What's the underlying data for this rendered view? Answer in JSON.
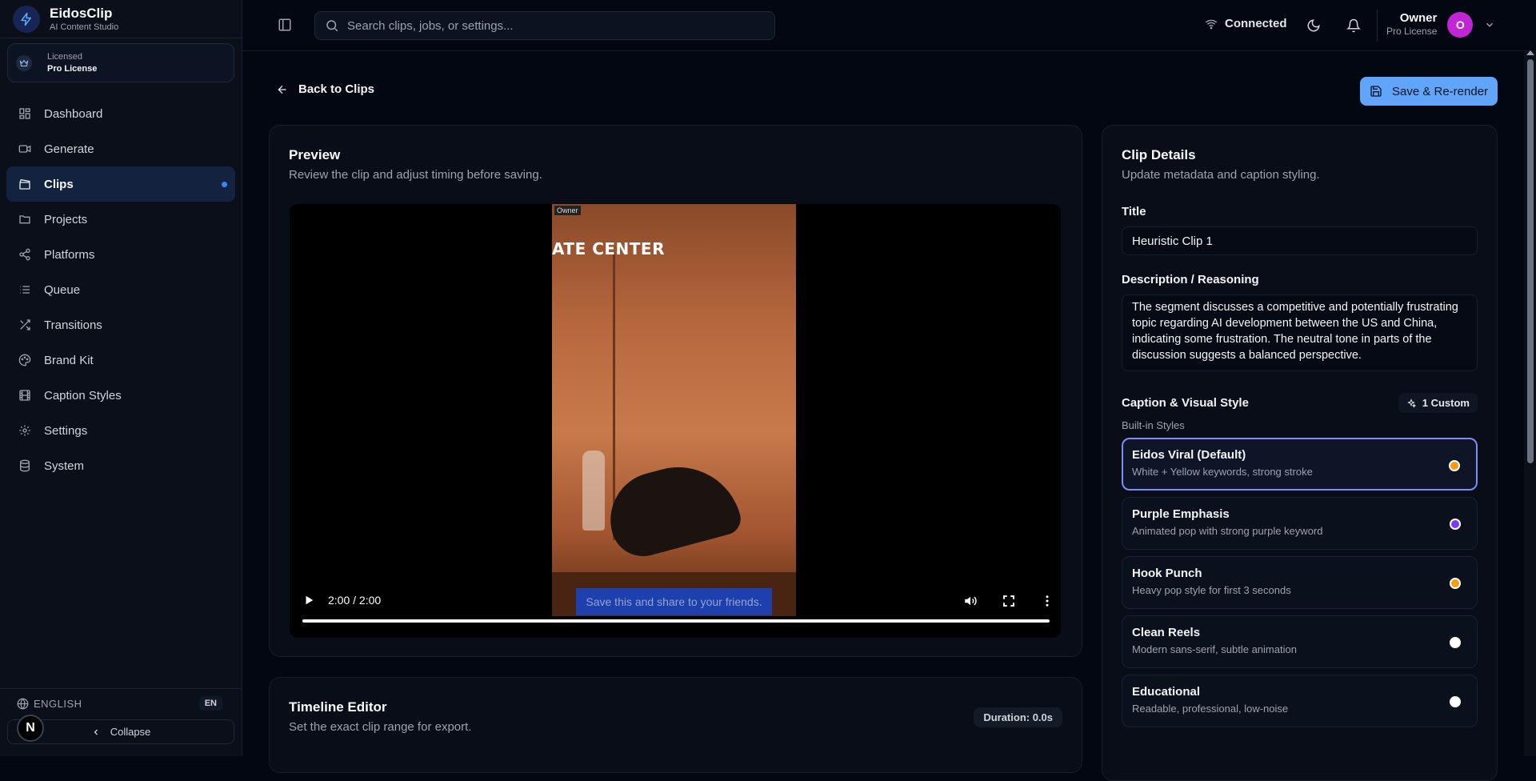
{
  "app": {
    "name": "EidosClip",
    "subtitle": "AI Content Studio"
  },
  "license": {
    "label": "Licensed",
    "value": "Pro License"
  },
  "nav": {
    "items": [
      {
        "label": "Dashboard",
        "icon": "dashboard-icon"
      },
      {
        "label": "Generate",
        "icon": "video-icon"
      },
      {
        "label": "Clips",
        "icon": "clapperboard-icon",
        "active": true
      },
      {
        "label": "Projects",
        "icon": "folder-icon"
      },
      {
        "label": "Platforms",
        "icon": "share-icon"
      },
      {
        "label": "Queue",
        "icon": "list-icon"
      },
      {
        "label": "Transitions",
        "icon": "shuffle-icon"
      },
      {
        "label": "Brand Kit",
        "icon": "palette-icon"
      },
      {
        "label": "Caption Styles",
        "icon": "film-icon"
      },
      {
        "label": "Settings",
        "icon": "gear-icon"
      },
      {
        "label": "System",
        "icon": "database-icon"
      }
    ]
  },
  "sidebar_bottom": {
    "language": "ENGLISH",
    "language_code": "EN",
    "collapse_label": "Collapse",
    "avatar_letter": "N"
  },
  "topbar": {
    "search_placeholder": "Search clips, jobs, or settings...",
    "connection_status": "Connected",
    "user_name": "Owner",
    "user_role": "Pro License",
    "user_initial": "O"
  },
  "page": {
    "back_label": "Back to Clips",
    "save_label": "Save & Re-render"
  },
  "preview": {
    "title": "Preview",
    "subtitle": "Review the clip and adjust timing before saving.",
    "frame_tag": "Owner",
    "frame_sign": "ATE CENTER",
    "caption_text": "Save this and share to your friends.",
    "time": "2:00 / 2:00",
    "progress": 1.0
  },
  "timeline": {
    "title": "Timeline Editor",
    "subtitle": "Set the exact clip range for export.",
    "duration": "Duration: 0.0s"
  },
  "details": {
    "title": "Clip Details",
    "subtitle": "Update metadata and caption styling.",
    "title_label": "Title",
    "title_value": "Heuristic Clip 1",
    "description_label": "Description / Reasoning",
    "description_value": "The segment discusses a competitive and potentially frustrating topic regarding AI development between the US and China, indicating some frustration. The neutral tone in parts of the discussion suggests a balanced perspective.",
    "style_section_label": "Caption & Visual Style",
    "custom_count": "1 Custom",
    "builtin_label": "Built-in Styles",
    "styles": [
      {
        "name": "Eidos Viral (Default)",
        "desc": "White + Yellow keywords, strong stroke",
        "color": "#f59e0b",
        "selected": true
      },
      {
        "name": "Purple Emphasis",
        "desc": "Animated pop with strong purple keyword",
        "color": "#7c3aed"
      },
      {
        "name": "Hook Punch",
        "desc": "Heavy pop style for first 3 seconds",
        "color": "#f59e0b"
      },
      {
        "name": "Clean Reels",
        "desc": "Modern sans-serif, subtle animation",
        "color": "#ffffff"
      },
      {
        "name": "Educational",
        "desc": "Readable, professional, low-noise",
        "color": "#ffffff"
      }
    ]
  },
  "colors": {
    "accent": "#60a5fa",
    "selected_border": "#818cf8",
    "avatar": "#c026d3",
    "background": "#030712"
  }
}
